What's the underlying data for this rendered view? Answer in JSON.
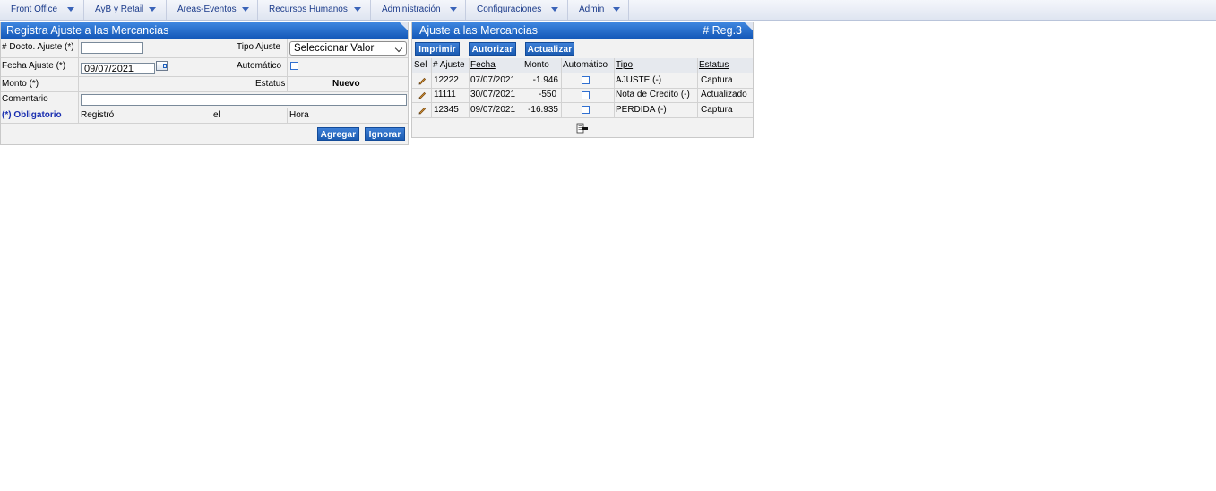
{
  "menu": [
    {
      "label": "Front Office"
    },
    {
      "label": "AyB y Retail"
    },
    {
      "label": "Áreas-Eventos"
    },
    {
      "label": "Recursos Humanos"
    },
    {
      "label": "Administración"
    },
    {
      "label": "Configuraciones"
    },
    {
      "label": "Admin"
    }
  ],
  "form": {
    "title": "Registra Ajuste a las Mercancias",
    "docto_label": "# Docto. Ajuste (*)",
    "docto_value": "",
    "tipo_label": "Tipo Ajuste",
    "tipo_value": "Seleccionar Valor",
    "fecha_label": "Fecha Ajuste (*)",
    "fecha_value": "09/07/2021",
    "automatico_label": "Automático",
    "automatico_checked": false,
    "monto_label": "Monto (*)",
    "estatus_label": "Estatus",
    "estatus_value": "Nuevo",
    "comentario_label": "Comentario",
    "comentario_value": "",
    "obligatorio_label": "(*) Obligatorio",
    "registro_label": "Registró",
    "el_label": "el",
    "hora_label": "Hora",
    "agregar_label": "Agregar",
    "ignorar_label": "Ignorar"
  },
  "list": {
    "title": "Ajuste a las Mercancias",
    "reg_count": "# Reg.3",
    "imprimir_label": "Imprimir",
    "autorizar_label": "Autorizar",
    "actualizar_label": "Actualizar",
    "columns": [
      "Sel",
      "# Ajuste",
      "Fecha",
      "Monto",
      "Automático",
      "Tipo",
      "Estatus"
    ],
    "rows": [
      {
        "ajuste": "12222",
        "fecha": "07/07/2021",
        "monto": "-1.946",
        "automatico": false,
        "tipo": "AJUSTE (-)",
        "estatus": "Captura"
      },
      {
        "ajuste": "11111",
        "fecha": "30/07/2021",
        "monto": "-550",
        "automatico": false,
        "tipo": "Nota de Credito (-)",
        "estatus": "Actualizado"
      },
      {
        "ajuste": "12345",
        "fecha": "09/07/2021",
        "monto": "-16.935",
        "automatico": false,
        "tipo": "PERDIDA (-)",
        "estatus": "Captura"
      }
    ]
  },
  "colors": {
    "accent": "#1c5cb2",
    "header": "#3f87e0",
    "menu_text": "#1a3a8a",
    "required": "#1a2fb0"
  }
}
